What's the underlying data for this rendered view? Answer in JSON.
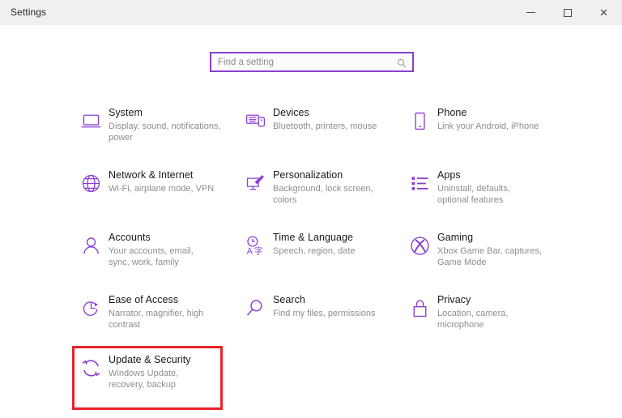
{
  "window": {
    "title": "Settings",
    "controls": [
      {
        "name": "minimize",
        "label": "—"
      },
      {
        "name": "maximize",
        "label": "□"
      },
      {
        "name": "close",
        "label": "✕"
      }
    ]
  },
  "search": {
    "placeholder": "Find a setting",
    "value": "",
    "icon": "search-icon"
  },
  "colors": {
    "accent": "#8a3fd1",
    "titlebar_bg": "#f0f0f0",
    "page_bg": "#ffffff",
    "title_text": "#1a1a1a",
    "desc_text": "#8e8e8e",
    "highlight": "#e8232a"
  },
  "tiles": [
    {
      "title": "System",
      "desc": "Display, sound, notifications, power",
      "icon": "laptop-icon"
    },
    {
      "title": "Devices",
      "desc": "Bluetooth, printers, mouse",
      "icon": "keyboard-mouse-icon"
    },
    {
      "title": "Phone",
      "desc": "Link your Android, iPhone",
      "icon": "phone-icon"
    },
    {
      "title": "Network & Internet",
      "desc": "Wi-Fi, airplane mode, VPN",
      "icon": "globe-icon"
    },
    {
      "title": "Personalization",
      "desc": "Background, lock screen, colors",
      "icon": "paintbrush-monitor-icon"
    },
    {
      "title": "Apps",
      "desc": "Uninstall, defaults, optional features",
      "icon": "list-icon"
    },
    {
      "title": "Accounts",
      "desc": "Your accounts, email, sync, work, family",
      "icon": "person-icon"
    },
    {
      "title": "Time & Language",
      "desc": "Speech, region, date",
      "icon": "clock-language-icon"
    },
    {
      "title": "Gaming",
      "desc": "Xbox Game Bar, captures, Game Mode",
      "icon": "xbox-icon"
    },
    {
      "title": "Ease of Access",
      "desc": "Narrator, magnifier, high contrast",
      "icon": "accessibility-clock-icon"
    },
    {
      "title": "Search",
      "desc": "Find my files, permissions",
      "icon": "magnifier-icon"
    },
    {
      "title": "Privacy",
      "desc": "Location, camera, microphone",
      "icon": "lock-icon"
    },
    {
      "title": "Update & Security",
      "desc": "Windows Update, recovery, backup",
      "icon": "sync-arrows-icon"
    }
  ],
  "annotation": {
    "target": "Update & Security",
    "shape": "rectangle",
    "color": "#e8232a"
  }
}
